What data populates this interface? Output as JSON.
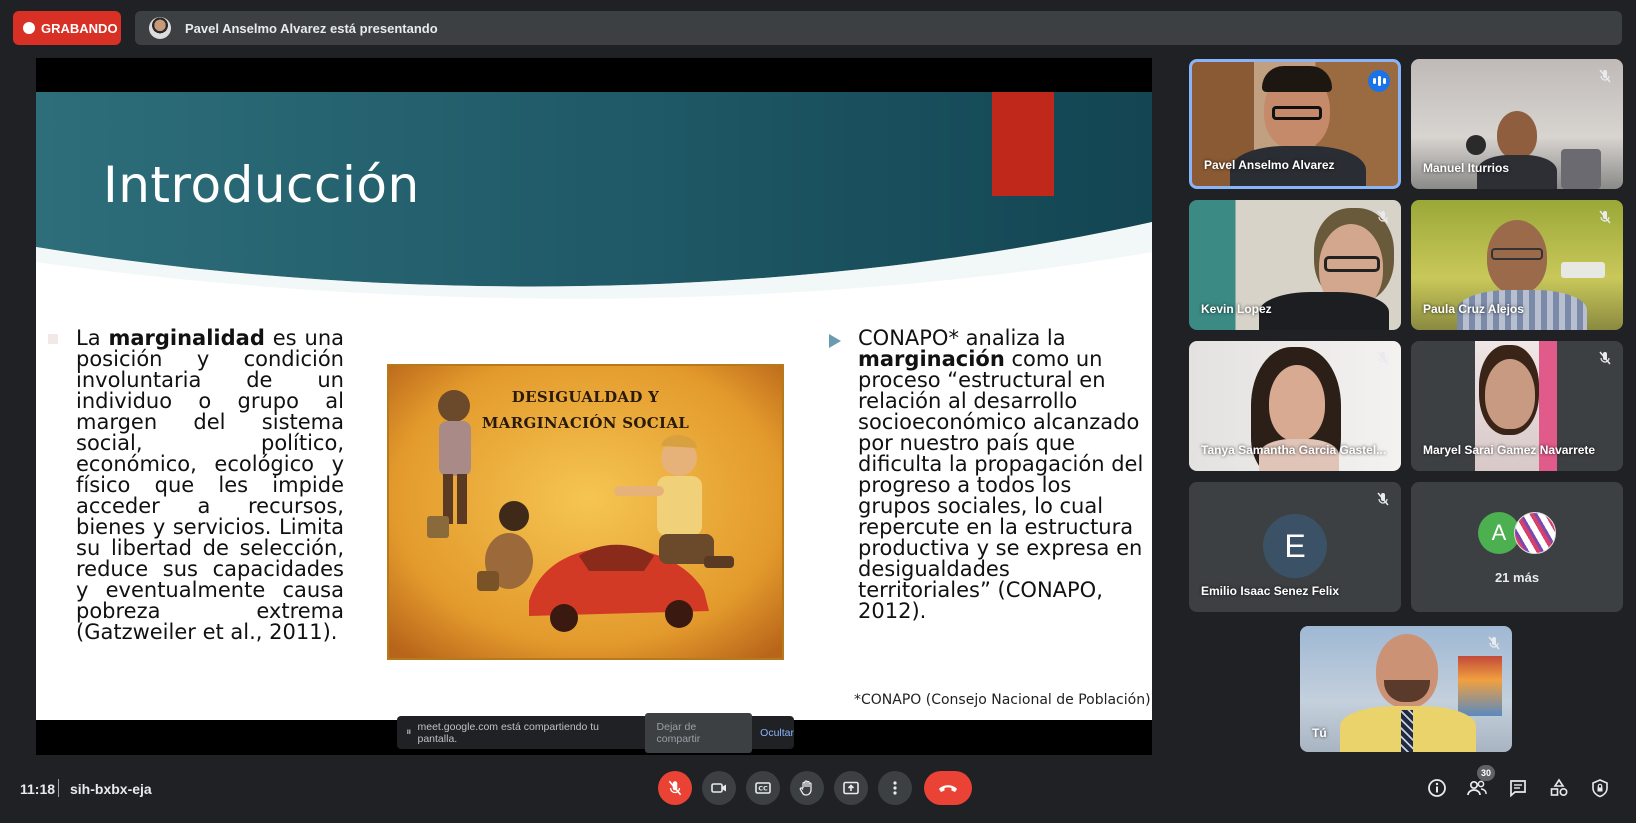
{
  "recording": {
    "label": "GRABANDO",
    "color": "#d93025"
  },
  "presenter_banner": {
    "text": "Pavel Anselmo Alvarez está presentando"
  },
  "slide": {
    "title": "Introducción",
    "left_text_pre": "La ",
    "left_text_bold": "marginalidad",
    "left_text_post": " es una posición y condición involuntaria de un individuo o grupo al margen del sistema social, político, económico, ecológico y físico que les impide acceder a recursos, bienes y servicios. Limita su libertad de selección, reduce sus capacidades y eventualmente causa pobreza extrema (Gatzweiler et al., 2011).",
    "right_text_pre": "CONAPO* analiza la ",
    "right_text_bold": "marginación",
    "right_text_post": " como un proceso “estructural en relación al desarrollo socioeconómico alcanzado por nuestro país que dificulta la propagación del progreso a todos los grupos sociales, lo cual repercute en la estructura productiva y se expresa en desigualdades territoriales” (CONAPO, 2012).",
    "footnote": "*CONAPO (Consejo Nacional de Población)",
    "image_caption_line1": "DESIGUALDAD Y",
    "image_caption_line2": "MARGINACIÓN SOCIAL"
  },
  "share_bar": {
    "message": "meet.google.com está compartiendo tu pantalla.",
    "stop_label": "Dejar de compartir",
    "hide_label": "Ocultar"
  },
  "participants": [
    {
      "name": "Pavel Anselmo Alvarez",
      "speaking": true
    },
    {
      "name": "Manuel Iturrios",
      "muted": true
    },
    {
      "name": "Kevin Lopez",
      "muted": true
    },
    {
      "name": "Paula Cruz Alejos",
      "muted": true
    },
    {
      "name": "Tanya Samantha Garcia Gastel...",
      "muted": true
    },
    {
      "name": "Maryel Sarai Gamez Navarrete",
      "muted": true
    },
    {
      "name": "Emilio Isaac Senez Felix",
      "initial": "E",
      "muted": true
    },
    {
      "name": "Tú",
      "muted": true
    }
  ],
  "more_tile": {
    "initial": "A",
    "label": "21 más"
  },
  "bottom": {
    "time": "11:18",
    "meeting_code": "sih-bxbx-eja",
    "people_count": "30"
  },
  "colors": {
    "accent_blue": "#1a73e8",
    "danger_red": "#ea4335",
    "panel": "#3c4043",
    "background": "#202124"
  }
}
